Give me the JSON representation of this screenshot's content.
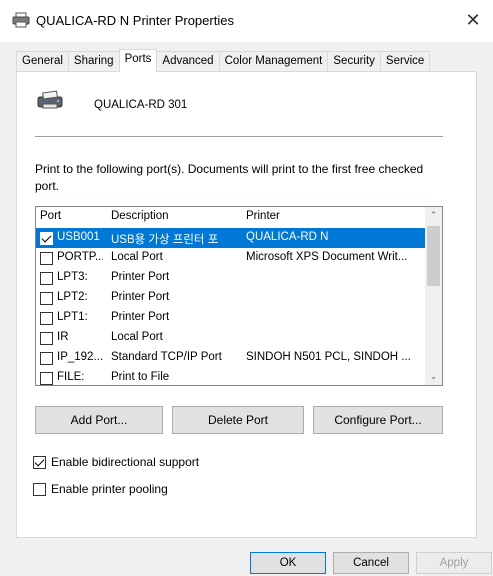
{
  "window": {
    "title": "QUALICA-RD N Printer Properties"
  },
  "tabs": [
    {
      "label": "General"
    },
    {
      "label": "Sharing"
    },
    {
      "label": "Ports"
    },
    {
      "label": "Advanced"
    },
    {
      "label": "Color Management"
    },
    {
      "label": "Security"
    },
    {
      "label": "Service"
    }
  ],
  "active_tab": "Ports",
  "printer": {
    "name": "QUALICA-RD 301"
  },
  "intro_text": "Print to the following port(s). Documents will print to the first free checked port.",
  "port_list": {
    "columns": {
      "port": "Port",
      "description": "Description",
      "printer": "Printer"
    },
    "rows": [
      {
        "checked": true,
        "selected": true,
        "port": "USB001",
        "description": "USB용 가상 프린터 포",
        "printer": "QUALICA-RD N"
      },
      {
        "checked": false,
        "selected": false,
        "port": "PORTP...",
        "description": "Local Port",
        "printer": "Microsoft XPS Document Writ..."
      },
      {
        "checked": false,
        "selected": false,
        "port": "LPT3:",
        "description": "Printer Port",
        "printer": ""
      },
      {
        "checked": false,
        "selected": false,
        "port": "LPT2:",
        "description": "Printer Port",
        "printer": ""
      },
      {
        "checked": false,
        "selected": false,
        "port": "LPT1:",
        "description": "Printer Port",
        "printer": ""
      },
      {
        "checked": false,
        "selected": false,
        "port": "IR",
        "description": "Local Port",
        "printer": ""
      },
      {
        "checked": false,
        "selected": false,
        "port": "IP_192....",
        "description": "Standard TCP/IP Port",
        "printer": "SINDOH N501 PCL, SINDOH ..."
      },
      {
        "checked": false,
        "selected": false,
        "port": "FILE:",
        "description": "Print to File",
        "printer": ""
      }
    ]
  },
  "buttons": {
    "add_port": "Add Port...",
    "delete_port": "Delete Port",
    "configure_port": "Configure Port..."
  },
  "options": {
    "bidirectional": {
      "label": "Enable bidirectional support",
      "checked": true
    },
    "pooling": {
      "label": "Enable printer pooling",
      "checked": false
    }
  },
  "dialog_buttons": {
    "ok": "OK",
    "cancel": "Cancel",
    "apply": "Apply"
  },
  "colors": {
    "selection": "#0078d7",
    "dialog_bg": "#f0f0f0"
  },
  "icons": {
    "title": "printer-icon",
    "close": "close-icon",
    "printer": "printer-icon",
    "scroll_up": "chevron-up-icon",
    "scroll_down": "chevron-down-icon"
  }
}
